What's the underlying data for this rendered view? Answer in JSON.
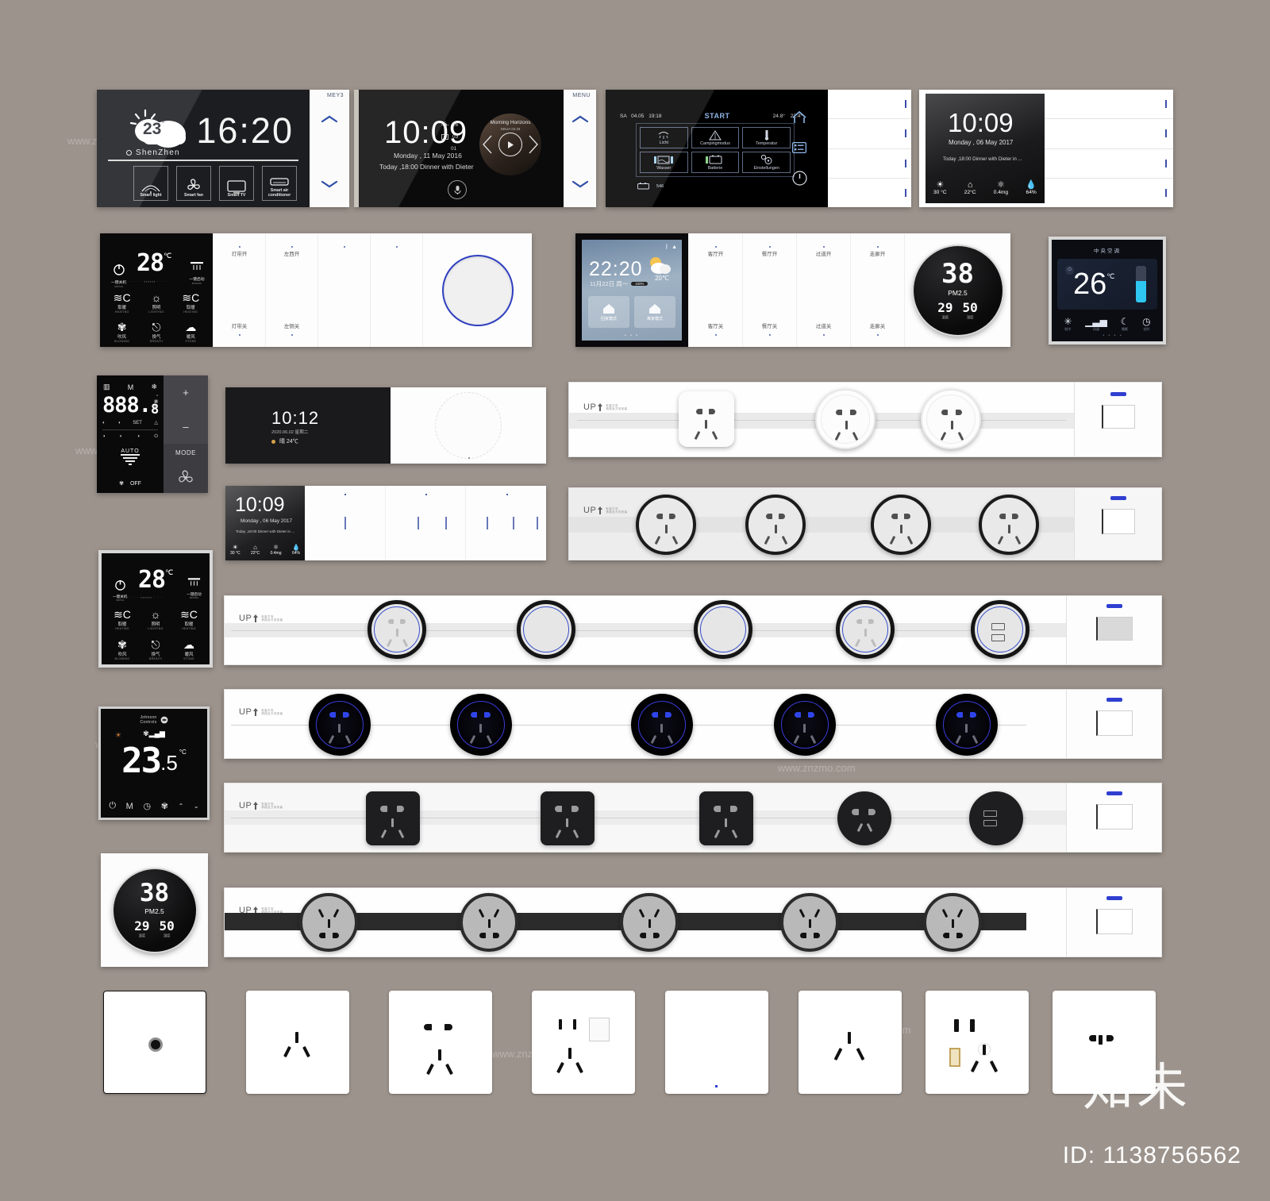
{
  "watermark": {
    "logo": "知未",
    "id_label": "ID: 1138756562",
    "tile_text": "www.znzmo.com"
  },
  "panels": {
    "weather_wall": {
      "temp": "23",
      "temp_unit": "°",
      "city": "ShenZhen",
      "clock": "16:20",
      "meta": "MEY3",
      "quick": [
        {
          "label": "Smart light",
          "icon": "lamp-icon"
        },
        {
          "label": "Smart fan",
          "icon": "fan-icon"
        },
        {
          "label": "Smart TV",
          "icon": "tv-icon"
        },
        {
          "label": "Smart air conditioner",
          "icon": "ac-icon"
        }
      ]
    },
    "media_wall": {
      "clock": "10:09",
      "date": "Monday , 11 May 2016",
      "event": "Today ,18:00  Dinner with Dieter",
      "stats": [
        {
          "icon": "sun-icon",
          "value": "26"
        },
        {
          "icon": "mail-icon",
          "value": "03"
        },
        {
          "icon": "doc-icon",
          "value": "01"
        }
      ],
      "media_title": "Morning Horizons",
      "media_sub": "NINJA  04:33",
      "meta": "MENU",
      "mic": "mic-icon"
    },
    "camper": {
      "day": "SA",
      "date": "04.05",
      "time": "19:18",
      "title": "START",
      "temp_out": "24.8°",
      "temp_in": "22.4°",
      "tiles": [
        {
          "label": "Licht",
          "icon": "light-icon"
        },
        {
          "label": "Campingmodus",
          "icon": "tent-icon"
        },
        {
          "label": "Temperatur",
          "icon": "thermometer-icon"
        },
        {
          "label": "Wasser",
          "icon": "water-tank-icon"
        },
        {
          "label": "Batterie",
          "icon": "battery-icon"
        },
        {
          "label": "Einstellungen",
          "icon": "settings-icon"
        }
      ],
      "status_value": "546",
      "side_icons": [
        "home-icon",
        "list-icon",
        "power-icon"
      ]
    },
    "lockscreen": {
      "clock": "10:09",
      "date": "Monday , 06 May 2017",
      "event": "Today ,18:00  Dinner with Dieter in ...",
      "metrics": [
        {
          "icon": "sun-icon",
          "value": "30 °C"
        },
        {
          "icon": "home-icon",
          "value": "22°C"
        },
        {
          "icon": "pm-icon",
          "value": "0.4mg"
        },
        {
          "icon": "humidity-icon",
          "value": "64%"
        }
      ]
    },
    "ac_black": {
      "temp": "28",
      "unit": "℃",
      "power_label": "一键关机",
      "power_label_en": "SWITCH",
      "rain_label": "一键启动",
      "rain_label_en": "BATHING",
      "cells": [
        {
          "icon": "heat-icon",
          "cn": "取暖",
          "en": "HEATING"
        },
        {
          "icon": "light-icon",
          "cn": "照明",
          "en": "LIGHTING"
        },
        {
          "icon": "heat-icon",
          "cn": "取暖",
          "en": "HEATING"
        },
        {
          "icon": "fan-icon",
          "cn": "吹风",
          "en": "BLOWING"
        },
        {
          "icon": "dry-icon",
          "cn": "换气",
          "en": "BREATH"
        },
        {
          "icon": "warm-icon",
          "cn": "暖风",
          "en": "STONE"
        }
      ]
    },
    "gang_switches_row2": [
      "灯带开",
      "左西开",
      "灯带关",
      "左侧关"
    ],
    "smart_weather": {
      "time": "22:20",
      "date": "11月22日 周一",
      "badge": "100%",
      "temp": "20℃",
      "icons": [
        "bluetooth-icon",
        "wifi-icon"
      ],
      "cards": [
        {
          "label": "回家模式",
          "icon": "home-arrive-icon"
        },
        {
          "label": "离家模式",
          "icon": "home-leave-icon"
        }
      ],
      "pager": "• • •"
    },
    "gang_switches_row2b": [
      "客厅开",
      "餐厅开",
      "过道开",
      "走廊开",
      "客厅关",
      "餐厅关",
      "过道关",
      "走廊关"
    ],
    "pm25_round": {
      "value": "38",
      "unit": "PM2.5",
      "temp": "29",
      "temp_label": "温度",
      "hum": "50",
      "hum_label": "湿度"
    },
    "central_ac": {
      "title": "中央空调",
      "temp": "26",
      "unit": "℃",
      "fill_percent": 58,
      "functions": [
        {
          "icon": "snowflake-icon",
          "label": "制冷"
        },
        {
          "icon": "fanspeed-icon",
          "label": "风速"
        },
        {
          "icon": "moon-icon",
          "label": "睡眠"
        },
        {
          "icon": "clock-icon",
          "label": "定时"
        }
      ],
      "pager": "• • • •"
    },
    "controller_888": {
      "display": "888.",
      "display_small": "8",
      "top_icons": [
        "heat-icon",
        "M",
        "snow-icon"
      ],
      "row_icons": [
        "half-icon",
        "half2-icon",
        "SET",
        "delta-icon"
      ],
      "row2_icons": [
        "moon1-icon",
        "moon2-icon",
        "moon3-icon",
        "power-icon"
      ],
      "auto_label": "AUTO",
      "fan_label": "OFF",
      "plus": "+",
      "minus": "–",
      "mode": "MODE"
    },
    "johnson": {
      "brand_line1": "Johnson",
      "brand_line2": "Controls",
      "temp": "23",
      "decimal": ".5",
      "unit": "°C",
      "buttons": [
        "power-icon",
        "M",
        "clock-icon",
        "fan-icon",
        "up-icon",
        "down-icon"
      ]
    },
    "mini_clock": {
      "time": "10:12",
      "date": "2020.06.02 星期二",
      "weather": "晴  24℃"
    },
    "pm25_panel_left": {
      "value": "38",
      "unit": "PM2.5",
      "temp": "29",
      "hum": "50",
      "temp_label": "温度",
      "hum_label": "湿度"
    }
  },
  "socket_strips": [
    {
      "id": "strip-square-round-mix",
      "up_label": "UP",
      "up_sub": "安装方向\n请按此方向安装",
      "rail": "light",
      "sockets": [
        {
          "type": "square",
          "style": "white"
        },
        {
          "type": "round",
          "style": "white-ring"
        },
        {
          "type": "round",
          "style": "white-ring"
        }
      ],
      "end_bluebar": true
    },
    {
      "id": "strip-round-black-ring",
      "up_label": "UP",
      "up_sub": "安装方向\n请按此方向安装",
      "rail": "light",
      "sockets": [
        {
          "type": "round",
          "style": "black-ring"
        },
        {
          "type": "round",
          "style": "black-ring"
        },
        {
          "type": "round",
          "style": "black-ring"
        },
        {
          "type": "round",
          "style": "black-ring"
        }
      ],
      "end_bluebar": true
    },
    {
      "id": "strip-blue-ring",
      "up_label": "UP",
      "up_sub": "安装方向\n请按此方向安装",
      "rail": "light",
      "sockets": [
        {
          "type": "round",
          "style": "blue-ring"
        },
        {
          "type": "round",
          "style": "blue-ring-blank"
        },
        {
          "type": "round",
          "style": "blue-ring-blank"
        },
        {
          "type": "round",
          "style": "blue-ring"
        },
        {
          "type": "round",
          "style": "blue-ring-usb"
        }
      ],
      "end_bluebar": true
    },
    {
      "id": "strip-dark-glow",
      "up_label": "UP",
      "up_sub": "安装方向\n请按此方向安装",
      "rail": "none",
      "sockets": [
        {
          "type": "round",
          "style": "dark-glow"
        },
        {
          "type": "round",
          "style": "dark-glow"
        },
        {
          "type": "round",
          "style": "dark-glow"
        },
        {
          "type": "round",
          "style": "dark-glow"
        },
        {
          "type": "round",
          "style": "dark-glow"
        }
      ],
      "end_bluebar": true
    },
    {
      "id": "strip-dark-square",
      "up_label": "UP",
      "up_sub": "安装方向\n请按此方向安装",
      "rail": "light",
      "sockets": [
        {
          "type": "square",
          "style": "dark"
        },
        {
          "type": "square",
          "style": "dark"
        },
        {
          "type": "square",
          "style": "dark"
        },
        {
          "type": "round",
          "style": "dark"
        },
        {
          "type": "round",
          "style": "dark-usb"
        }
      ],
      "end_bluebar": true
    },
    {
      "id": "strip-darkrail-grey",
      "up_label": "UP",
      "up_sub": "安装方向\n请按此方向安装",
      "rail": "dark",
      "sockets": [
        {
          "type": "round",
          "style": "grey"
        },
        {
          "type": "round",
          "style": "grey"
        },
        {
          "type": "round",
          "style": "grey"
        },
        {
          "type": "round",
          "style": "grey"
        },
        {
          "type": "round",
          "style": "grey"
        }
      ],
      "end_bluebar": true
    }
  ],
  "faceplates": [
    {
      "name": "tv-coax-outlet",
      "icon": "coax-icon"
    },
    {
      "name": "three-pin-outlet",
      "icon": "three-pin-icon"
    },
    {
      "name": "five-hole-outlet",
      "icon": "five-hole-icon"
    },
    {
      "name": "outlet-with-switch",
      "icon": "outlet-switch-icon"
    },
    {
      "name": "blank-plate",
      "icon": "blank-icon"
    },
    {
      "name": "three-pin-outlet-2",
      "icon": "three-pin-icon"
    },
    {
      "name": "usb-outlet",
      "icon": "usb-outlet-icon"
    },
    {
      "name": "two-pin-outlet",
      "icon": "two-pin-icon"
    }
  ]
}
